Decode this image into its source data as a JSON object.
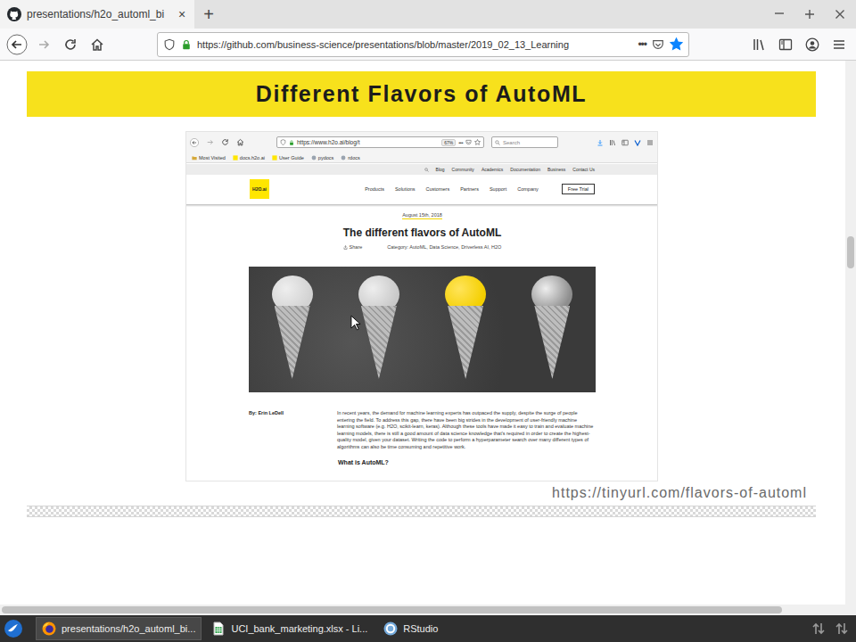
{
  "tabs": [
    {
      "label": "presentations/h2o_automl_bi",
      "selected": true,
      "close": "×"
    }
  ],
  "new_tab": "+",
  "toolbar": {
    "url": "https://github.com/business-science/presentations/blob/master/2019_02_13_Learning",
    "more": "•••",
    "bookmarked": true
  },
  "slide": {
    "title": "Different Flavors of AutoML",
    "link": "https://tinyurl.com/flavors-of-automl"
  },
  "embedded": {
    "url": "https://www.h2o.ai/blog/t",
    "zoom": "67%",
    "more": "•••",
    "search_placeholder": "Search",
    "bookmarks": [
      "Most Visited",
      "docs.h2o.ai",
      "User Guide",
      "pydocs",
      "rdocs"
    ],
    "top_links": [
      "Blog",
      "Community",
      "Academics",
      "Documentation",
      "Business",
      "Contact Us"
    ],
    "logo": "H2O.ai",
    "menu": [
      "Products",
      "Solutions",
      "Customers",
      "Partners",
      "Support",
      "Company"
    ],
    "cta": "Free Trial",
    "date": "August 15th, 2018",
    "title": "The different flavors of AutoML",
    "share": "Share",
    "category": "Category: AutoML, Data Science, Driverless AI, H2O",
    "author": "By: Erin LeDell",
    "paragraph": "In recent years, the demand for machine learning experts has outpaced the supply, despite the surge of people entering the field. To address this gap, there have been big strides in the development of user-friendly machine learning software (e.g. H2O, scikit-learn, keras). Although these tools have made it easy to train and evaluate machine learning models, there is still a good amount of data science knowledge that's required in order to create the highest-quality model, given your dataset. Writing the code to perform a hyperparameter search over many different types of algorithms can also be time consuming and repetitive work.",
    "subheading": "What is AutoML?"
  },
  "taskbar": {
    "items": [
      {
        "label": "presentations/h2o_automl_bi...",
        "selected": true,
        "kind": "firefox"
      },
      {
        "label": "UCI_bank_marketing.xlsx - Li...",
        "selected": false,
        "kind": "calc"
      },
      {
        "label": "RStudio",
        "selected": false,
        "kind": "rstudio"
      }
    ]
  }
}
